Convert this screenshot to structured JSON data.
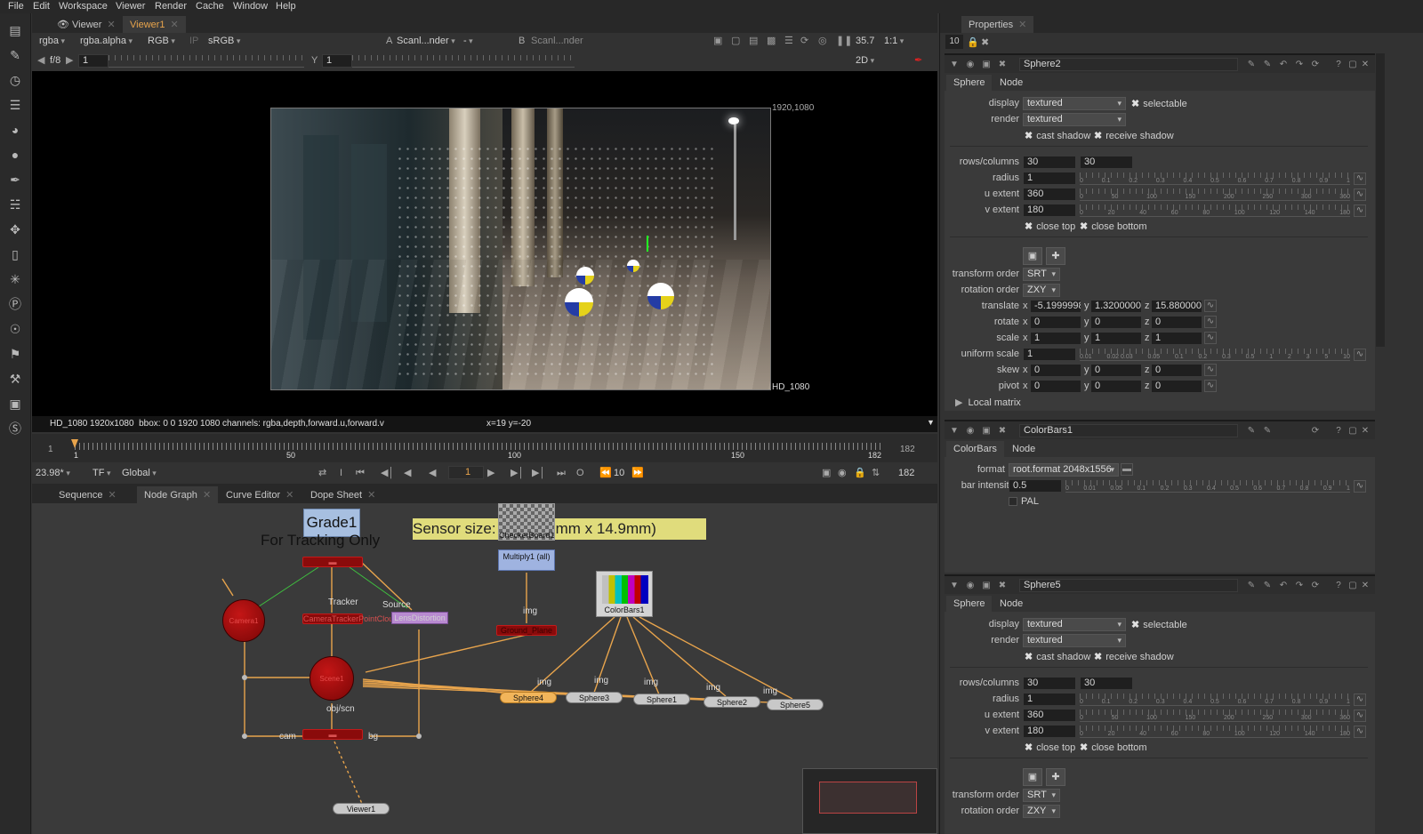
{
  "menu": [
    "File",
    "Edit",
    "Workspace",
    "Viewer",
    "Render",
    "Cache",
    "Window",
    "Help"
  ],
  "viewer_tabs": {
    "tab1": "Viewer",
    "tab2": "Viewer1"
  },
  "viewer_toolbar": {
    "channels": "rgba",
    "alpha": "rgba.alpha",
    "colorspace": "RGB",
    "ip": "IP",
    "lut": "sRGB",
    "a_label": "A",
    "a_input": "Scanl...nder",
    "a_mode": "-",
    "b_label": "B",
    "b_input": "Scanl...nder",
    "zoom": "35.7",
    "proxy": "1:1",
    "fstop": "f/8",
    "gain": "1",
    "y_label": "Y",
    "gamma": "1",
    "view_mode": "2D"
  },
  "viewer": {
    "res_top": "1920,1080",
    "res_bottom": "HD_1080",
    "info": "HD_1080 1920x1080  bbox: 0 0 1920 1080 channels: rgba,depth,forward.u,forward.v",
    "coords": "x=19 y=-20"
  },
  "timeline": {
    "start": "1",
    "end": "182",
    "ticks": [
      "1",
      "50",
      "100",
      "150",
      "182"
    ],
    "fps": "23.98*",
    "tf": "TF",
    "scope": "Global",
    "frame": "1",
    "step": "10",
    "end_frame": "182"
  },
  "bottom_tabs": [
    "Sequence",
    "Node Graph",
    "Curve Editor",
    "Dope Sheet"
  ],
  "nodegraph": {
    "grade": "Grade1",
    "tracking_note": "For Tracking Only",
    "sensor": "Sensor size:      (22.3mm x 14.9mm)",
    "checker": "CheckerBoard1",
    "multiply": "Multiply1 (all)",
    "colorbars": "ColorBars1",
    "ground": "Ground_Plane",
    "camera": "Camera1",
    "scene": "Scene1",
    "tracker_lbl": "Tracker",
    "source_lbl": "Source",
    "camtrack": "CameraTrackerPointCloud1",
    "lensdist": "LensDistortion",
    "objscn": "obj/scn",
    "cam": "cam",
    "bg": "bg",
    "img": "img",
    "viewer": "Viewer1",
    "spheres": [
      "Sphere4",
      "Sphere3",
      "Sphere1",
      "Sphere2",
      "Sphere5"
    ]
  },
  "properties": {
    "title": "Properties",
    "count": "10",
    "sphere2": {
      "name": "Sphere2",
      "tabs": [
        "Sphere",
        "Node"
      ],
      "display": "textured",
      "render": "textured",
      "selectable": "selectable",
      "cast": "cast shadow",
      "receive": "receive shadow",
      "rows_label": "rows/columns",
      "rows": "30",
      "cols": "30",
      "radius_label": "radius",
      "radius": "1",
      "uext_label": "u extent",
      "uext": "360",
      "vext_label": "v extent",
      "vext": "180",
      "close_top": "close top",
      "close_bottom": "close bottom",
      "transform_order_label": "transform order",
      "transform_order": "SRT",
      "rotation_order_label": "rotation order",
      "rotation_order": "ZXY",
      "translate_label": "translate",
      "tx": "-5.1999998",
      "ty": "1.32000005",
      "tz": "15.8800001",
      "rotate_label": "rotate",
      "rx": "0",
      "ry": "0",
      "rz": "0",
      "scale_label": "scale",
      "sx": "1",
      "sy": "1",
      "sz": "1",
      "uniform_label": "uniform scale",
      "uniform": "1",
      "skew_label": "skew",
      "kx": "0",
      "ky": "0",
      "kz": "0",
      "pivot_label": "pivot",
      "px": "0",
      "py": "0",
      "pz": "0",
      "local_matrix": "Local matrix",
      "radius_ticks": [
        "0",
        "0.1",
        "0.2",
        "0.3",
        "0.4",
        "0.5",
        "0.6",
        "0.7",
        "0.8",
        "0.9",
        "1"
      ],
      "u_ticks": [
        "0",
        "50",
        "100",
        "150",
        "200",
        "250",
        "300",
        "360"
      ],
      "v_ticks": [
        "0",
        "20",
        "40",
        "60",
        "80",
        "100",
        "120",
        "140",
        "180"
      ],
      "uniform_ticks": [
        "0.01",
        "0.02 0.03",
        "0.05",
        "0.1",
        "0.2",
        "0.3",
        "0.5",
        "1",
        "2",
        "3",
        "5",
        "10"
      ]
    },
    "colorbars": {
      "name": "ColorBars1",
      "tabs": [
        "ColorBars",
        "Node"
      ],
      "format_label": "format",
      "format": "root.format 2048x1556",
      "intensity_label": "bar intensity",
      "intensity": "0.5",
      "pal": "PAL",
      "intensity_ticks": [
        "0",
        "0.01",
        "0.05",
        "0.1",
        "0.2",
        "0.3",
        "0.4",
        "0.5",
        "0.6",
        "0.7",
        "0.8",
        "0.9",
        "1"
      ]
    },
    "sphere5": {
      "name": "Sphere5",
      "tabs": [
        "Sphere",
        "Node"
      ],
      "display": "textured",
      "render": "textured",
      "selectable": "selectable",
      "cast": "cast shadow",
      "receive": "receive shadow",
      "rows_label": "rows/columns",
      "rows": "30",
      "cols": "30",
      "radius_label": "radius",
      "radius": "1",
      "uext_label": "u extent",
      "uext": "360",
      "vext_label": "v extent",
      "vext": "180",
      "close_top": "close top",
      "close_bottom": "close bottom",
      "transform_order_label": "transform order",
      "transform_order": "SRT",
      "rotation_order_label": "rotation order",
      "rotation_order": "ZXY"
    }
  }
}
